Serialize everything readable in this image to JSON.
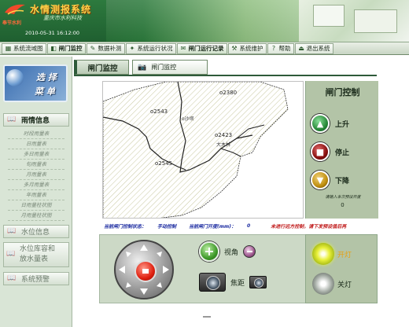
{
  "header": {
    "app_title": "水情测报系统",
    "app_subtitle": "重庆市水利科技",
    "brand_mark": "奉节水利",
    "datetime": "2010-05-31 16:12:00"
  },
  "nav": [
    {
      "label": "系统流域图",
      "icon": "map-icon"
    },
    {
      "label": "闸门监控",
      "icon": "gate-icon"
    },
    {
      "label": "数据补测",
      "icon": "data-icon"
    },
    {
      "label": "系统运行状况",
      "icon": "status-icon"
    },
    {
      "label": "闸门运行记录",
      "icon": "record-icon"
    },
    {
      "label": "系统维护",
      "icon": "wrench-icon"
    },
    {
      "label": "帮助",
      "icon": "help-icon"
    },
    {
      "label": "退出系统",
      "icon": "exit-icon"
    }
  ],
  "sidebar": {
    "select_menu_line1": "选 择",
    "select_menu_line2": "菜 单",
    "rain_info": "雨情信息",
    "rain_items": [
      "时段雨量表",
      "日雨量表",
      "多日雨量表",
      "旬雨量表",
      "月雨量表",
      "多月雨量表",
      "年雨量表",
      "日雨量柱状图",
      "月雨量柱状图"
    ],
    "water_level": "水位信息",
    "reservoir_line1": "水位库容和",
    "reservoir_line2": "放水量表",
    "system_alarm": "系统预警"
  },
  "tabs": {
    "gate_monitor": "闸门监控",
    "gate_watch": "闸门监控"
  },
  "map": {
    "stations": [
      "2380",
      "2543",
      "2423",
      "2545"
    ],
    "rivers": [
      "沙坝",
      "大木林"
    ]
  },
  "gate_control": {
    "title": "闸门控制",
    "up": "上升",
    "stop": "停止",
    "down": "下降",
    "note": "请输入本次预设开度",
    "note_value": "0"
  },
  "status_bar": {
    "current_control_label": "当前闸门控制状态：",
    "current_control_value": "手动控制",
    "current_opening_label": "当前闸门开度(mm)：",
    "current_opening_value": "0",
    "warning": "未进行远方控制，请下发预设值后再"
  },
  "camera": {
    "view_angle": "视角",
    "focus": "焦距",
    "light_on": "开灯",
    "light_off": "关灯"
  },
  "colors": {
    "header_green": "#2c7a3c",
    "panel_green": "#b3c4a7",
    "status_blue": "#1a2aa0",
    "warning_red": "#c01a1a",
    "up_green": "#2a8a3a",
    "stop_red": "#8a1010",
    "down_gold": "#c09010"
  }
}
